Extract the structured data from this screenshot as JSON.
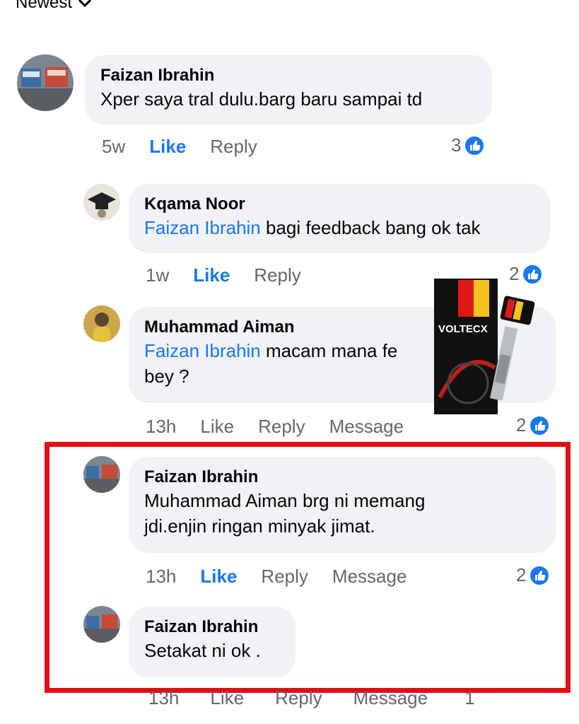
{
  "sort": {
    "label": "Newest"
  },
  "comments": [
    {
      "author": "Faizan Ibrahin",
      "mention": "",
      "text": "Xper saya tral dulu.barg baru sampai td",
      "time": "5w",
      "like": "Like",
      "reply": "Reply",
      "message": "",
      "reactions": "3"
    },
    {
      "author": "Kqama Noor",
      "mention": "Faizan Ibrahin",
      "text": " bagi feedback bang ok tak",
      "time": "1w",
      "like": "Like",
      "reply": "Reply",
      "message": "",
      "reactions": "2"
    },
    {
      "author": "Muhammad Aiman",
      "mention": "Faizan Ibrahin",
      "text": " macam mana fe",
      "text2": "bey ?",
      "time": "13h",
      "like": "Like",
      "reply": "Reply",
      "message": "Message",
      "reactions": "2"
    },
    {
      "author": "Faizan Ibrahin",
      "mention": "",
      "text": "Muhammad Aiman brg ni memang",
      "text2": "jdi.enjin ringan minyak jimat.",
      "time": "13h",
      "like": "Like",
      "reply": "Reply",
      "message": "Message",
      "reactions": "2"
    },
    {
      "author": "Faizan Ibrahin",
      "mention": "",
      "text": "Setakat ni ok .",
      "time": "13h",
      "like": "Like",
      "reply": "Reply",
      "message": "Message",
      "reactions": "1"
    }
  ],
  "product": {
    "brand": "VOLTECX"
  },
  "colors": {
    "accent": "#1877f2",
    "highlight": "#e10f16",
    "bubble": "#f0f2f5",
    "muted": "#65676b"
  }
}
